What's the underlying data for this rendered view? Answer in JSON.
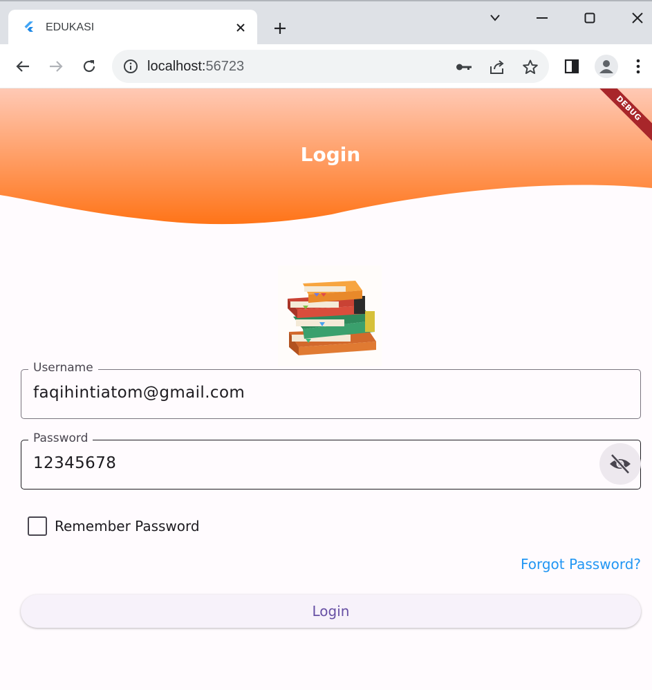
{
  "browser": {
    "tab_title": "EDUKASI",
    "url_host": "localhost:",
    "url_port": "56723"
  },
  "app": {
    "header_title": "Login",
    "debug_banner": "DEBUG",
    "username_label": "Username",
    "username_value": "faqihintiatom@gmail.com",
    "password_label": "Password",
    "password_value": "12345678",
    "remember_label": "Remember Password",
    "remember_checked": false,
    "forgot_label": "Forgot Password?",
    "login_button": "Login"
  },
  "colors": {
    "header_top": "#ffc9b5",
    "header_bottom": "#ff7418",
    "link": "#2196f3",
    "button_text": "#6750a4"
  }
}
